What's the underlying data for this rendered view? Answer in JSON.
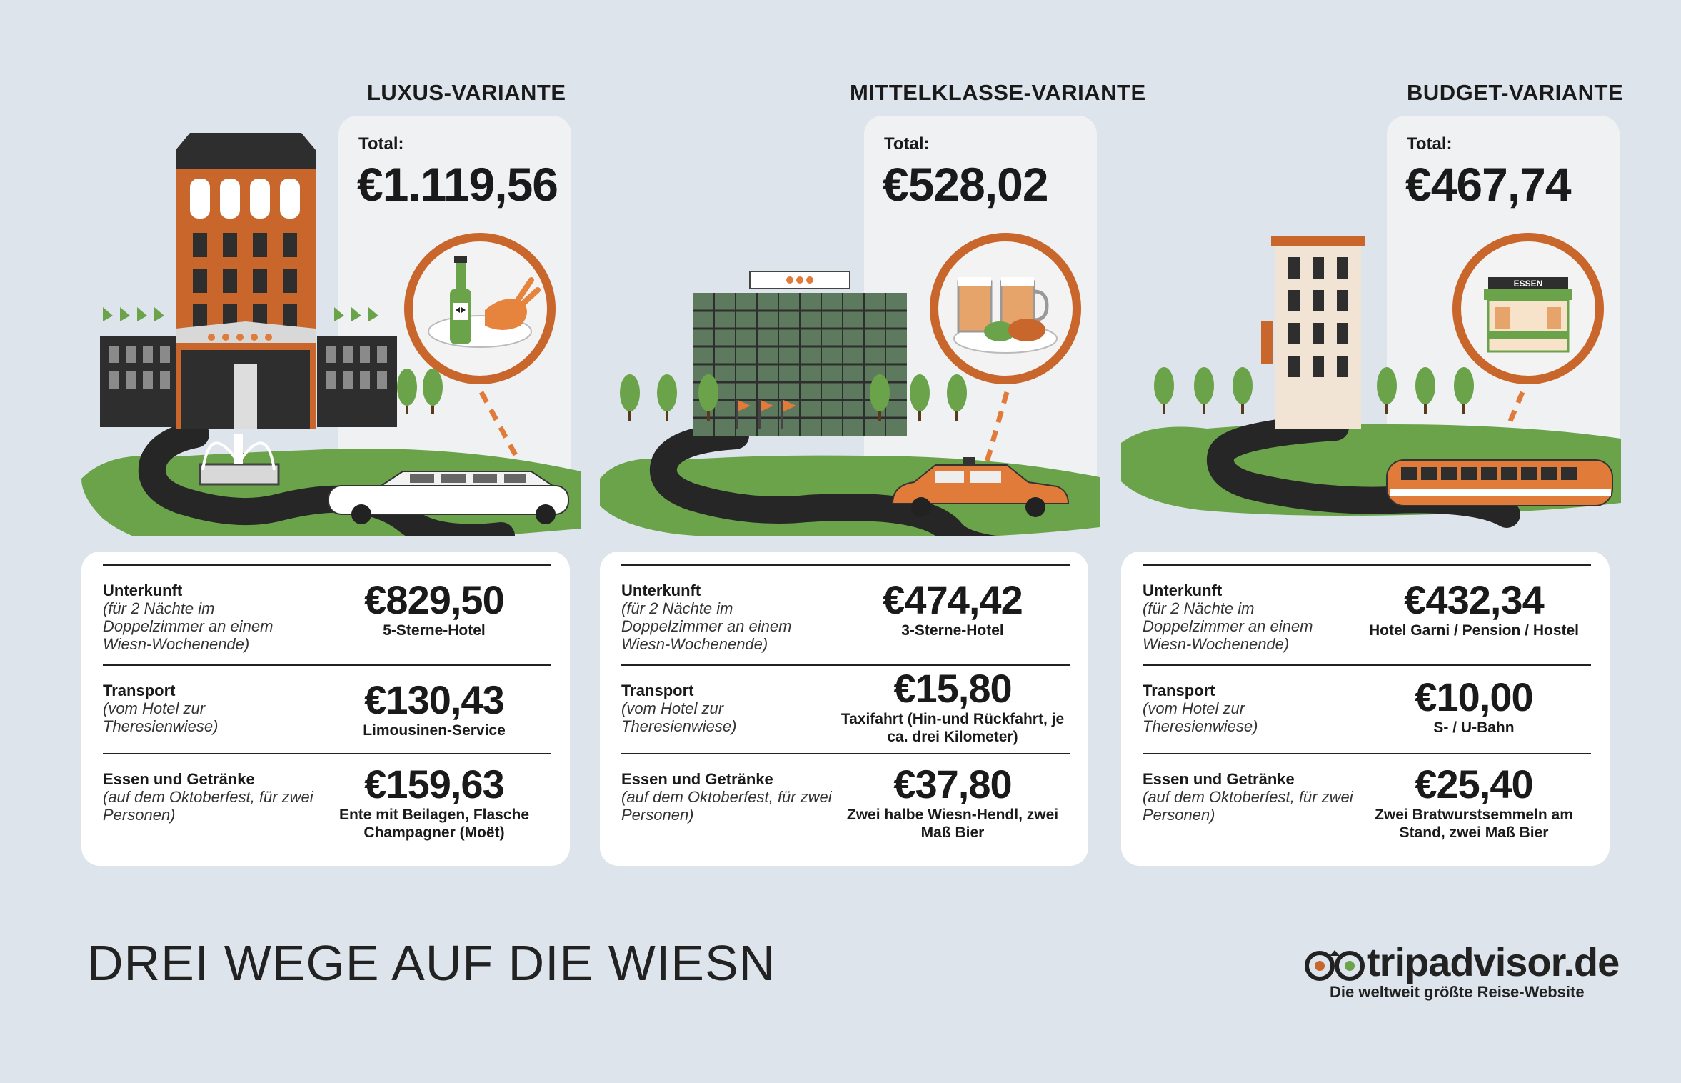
{
  "title": "DREI WEGE AUF DIE WIESN",
  "brand": {
    "name": "tripadvisor.de",
    "tagline": "Die weltweit größte Reise-Website"
  },
  "variants": [
    {
      "title": "LUXUS-VARIANTE",
      "total_label": "Total:",
      "total": "€1.119,56",
      "rows": [
        {
          "label": "Unterkunft",
          "sub": "(für 2 Nächte im Doppelzimmer an einem Wiesn-Wochenende)",
          "amount": "€829,50",
          "desc": "5-Sterne-Hotel"
        },
        {
          "label": "Transport",
          "sub": "(vom Hotel zur Theresienwiese)",
          "amount": "€130,43",
          "desc": "Limousinen-Service"
        },
        {
          "label": "Essen und Getränke",
          "sub": "(auf dem Oktoberfest, für zwei Personen)",
          "amount": "€159,63",
          "desc": "Ente mit Beilagen, Flasche Champagner (Moët)"
        }
      ]
    },
    {
      "title": "MITTELKLASSE-VARIANTE",
      "total_label": "Total:",
      "total": "€528,02",
      "rows": [
        {
          "label": "Unterkunft",
          "sub": "(für 2 Nächte im Doppelzimmer an einem Wiesn-Wochenende)",
          "amount": "€474,42",
          "desc": "3-Sterne-Hotel"
        },
        {
          "label": "Transport",
          "sub": "(vom Hotel zur Theresienwiese)",
          "amount": "€15,80",
          "desc": "Taxifahrt (Hin-und Rückfahrt, je ca. drei Kilometer)"
        },
        {
          "label": "Essen und Getränke",
          "sub": "(auf dem Oktoberfest, für zwei Personen)",
          "amount": "€37,80",
          "desc": "Zwei halbe Wiesn-Hendl, zwei Maß Bier"
        }
      ]
    },
    {
      "title": "BUDGET-VARIANTE",
      "total_label": "Total:",
      "total": "€467,74",
      "booth_sign": "ESSEN",
      "rows": [
        {
          "label": "Unterkunft",
          "sub": "(für 2 Nächte im Doppelzimmer an einem Wiesn-Wochenende)",
          "amount": "€432,34",
          "desc": "Hotel Garni / Pension / Hostel"
        },
        {
          "label": "Transport",
          "sub": "(vom Hotel zur Theresienwiese)",
          "amount": "€10,00",
          "desc": "S- / U-Bahn"
        },
        {
          "label": "Essen und Getränke",
          "sub": "(auf dem Oktoberfest, für zwei Personen)",
          "amount": "€25,40",
          "desc": "Zwei Bratwurstsemmeln am Stand, zwei Maß Bier"
        }
      ]
    }
  ]
}
